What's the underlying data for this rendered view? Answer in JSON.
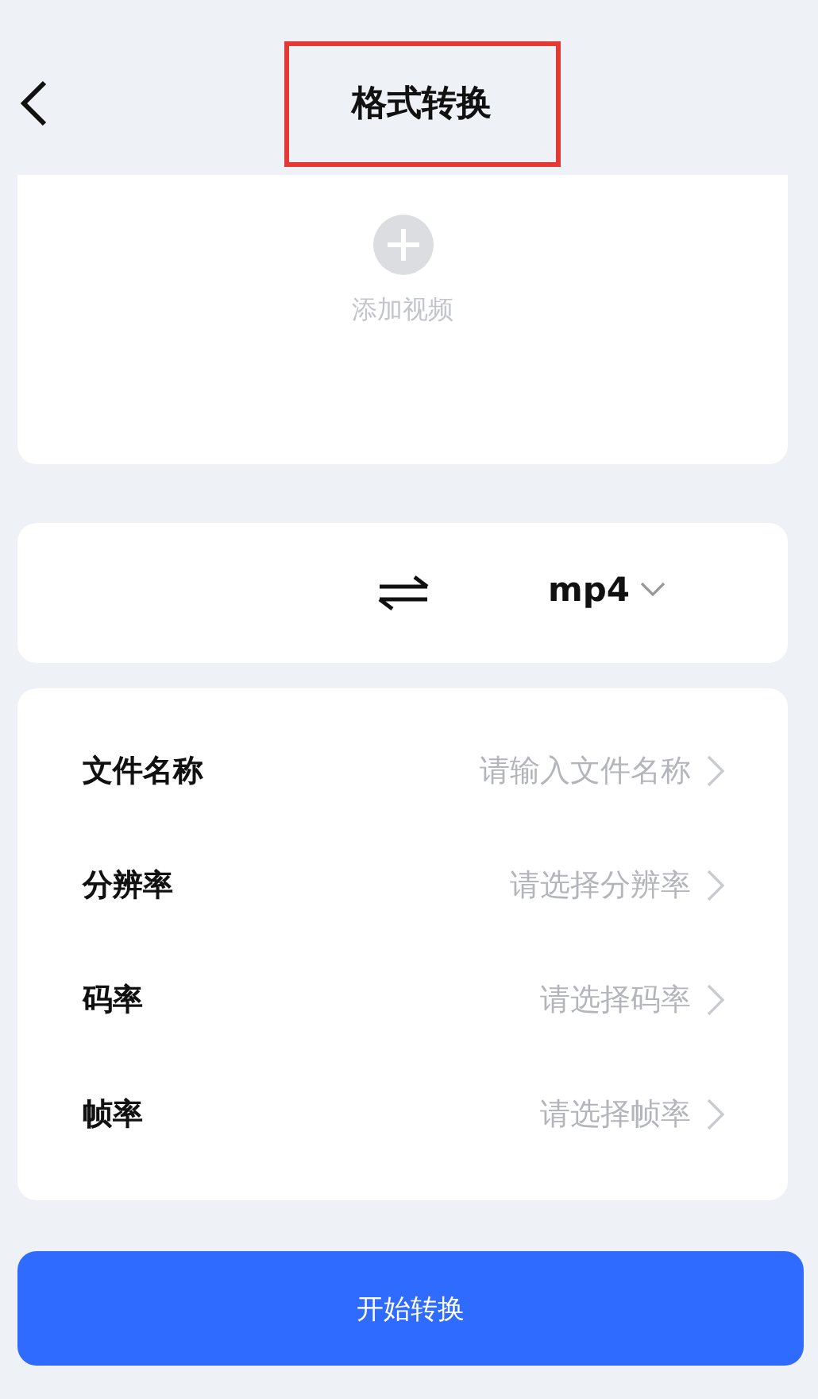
{
  "header": {
    "title": "格式转换",
    "highlighted": true
  },
  "upload": {
    "label": "添加视频"
  },
  "format": {
    "target": "mp4"
  },
  "settings": [
    {
      "label": "文件名称",
      "placeholder": "请输入文件名称"
    },
    {
      "label": "分辨率",
      "placeholder": "请选择分辨率"
    },
    {
      "label": "码率",
      "placeholder": "请选择码率"
    },
    {
      "label": "帧率",
      "placeholder": "请选择帧率"
    }
  ],
  "start_button": "开始转换"
}
